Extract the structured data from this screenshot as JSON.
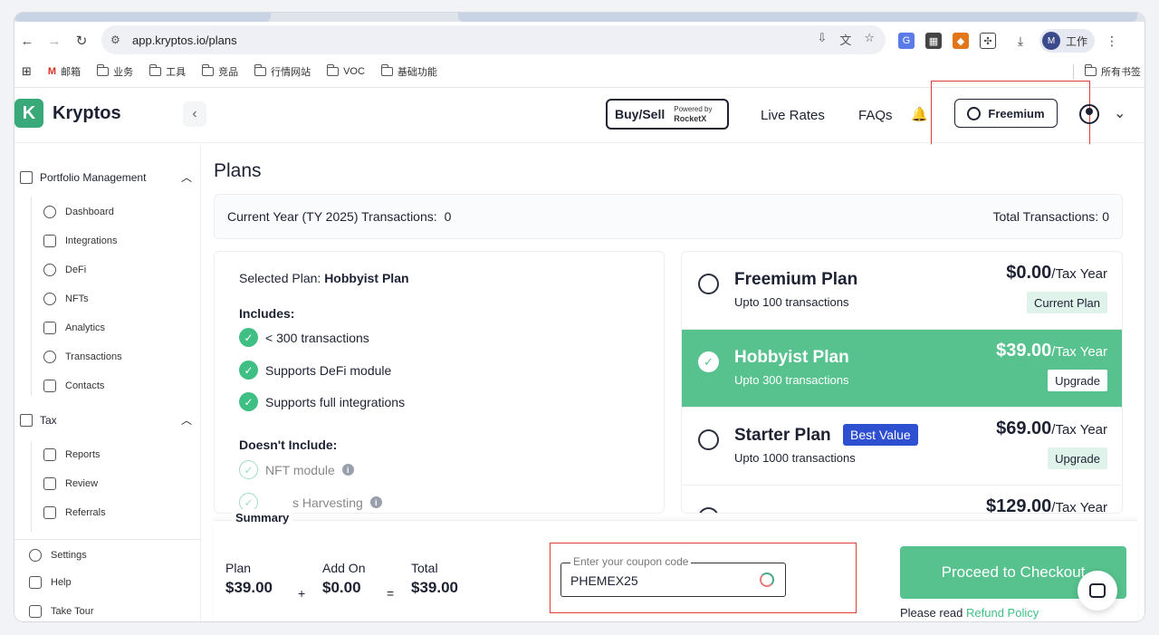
{
  "browser": {
    "url": "app.kryptos.io/plans",
    "profile_initial": "M",
    "profile_name": "工作",
    "bookmarks": [
      "邮箱",
      "业务",
      "工具",
      "竞品",
      "行情网站",
      "VOC",
      "基础功能"
    ],
    "all_bookmarks": "所有书签"
  },
  "header": {
    "brand": "Kryptos",
    "buysell_label": "Buy/Sell",
    "powered_by": "Powered by",
    "powered_brand": "RocketX",
    "live_rates": "Live Rates",
    "faqs": "FAQs",
    "plan_button": "Freemium"
  },
  "sidebar": {
    "section_portfolio": "Portfolio Management",
    "portfolio_items": [
      "Dashboard",
      "Integrations",
      "DeFi",
      "NFTs",
      "Analytics",
      "Transactions",
      "Contacts"
    ],
    "section_tax": "Tax",
    "tax_items": [
      "Reports",
      "Review",
      "Referrals"
    ],
    "bottom_items": [
      "Settings",
      "Help",
      "Take Tour"
    ]
  },
  "main": {
    "title": "Plans",
    "current_year_label": "Current Year (TY 2025) Transactions:",
    "current_year_value": "0",
    "total_label": "Total Transactions:",
    "total_value": "0",
    "selected_plan_label": "Selected Plan:",
    "selected_plan_name": "Hobbyist Plan",
    "includes_label": "Includes:",
    "includes": [
      "< 300 transactions",
      "Supports DeFi module",
      "Supports full integrations"
    ],
    "excludes_label": "Doesn't Include:",
    "excludes": [
      "NFT module",
      "s Harvesting"
    ]
  },
  "plans": [
    {
      "name": "Freemium Plan",
      "sub": "Upto 100 transactions",
      "price": "$0.00",
      "per": "/Tax Year",
      "tag": "Current Plan",
      "selected": false
    },
    {
      "name": "Hobbyist Plan",
      "sub": "Upto 300 transactions",
      "price": "$39.00",
      "per": "/Tax Year",
      "tag": "Upgrade",
      "selected": true
    },
    {
      "name": "Starter Plan",
      "sub": "Upto 1000 transactions",
      "price": "$69.00",
      "per": "/Tax Year",
      "tag": "Upgrade",
      "badge": "Best Value",
      "selected": false
    },
    {
      "name": "",
      "sub": "",
      "price": "$129.00",
      "per": "/Tax Year",
      "tag": "",
      "selected": false
    }
  ],
  "summary": {
    "tab_label": "Summary",
    "plan_label": "Plan",
    "plan_value": "$39.00",
    "addon_label": "Add On",
    "addon_value": "$0.00",
    "total_label": "Total",
    "total_value": "$39.00",
    "plus": "+",
    "equals": "=",
    "coupon_legend": "Enter your coupon code",
    "coupon_value": "PHEMEX25",
    "checkout_label": "Proceed to Checkout",
    "refund_prefix": "Please read",
    "refund_link": "Refund Policy"
  },
  "colors": {
    "accent": "#57c28e",
    "badge": "#2f4fd1",
    "highlight": "#e03b3b"
  }
}
